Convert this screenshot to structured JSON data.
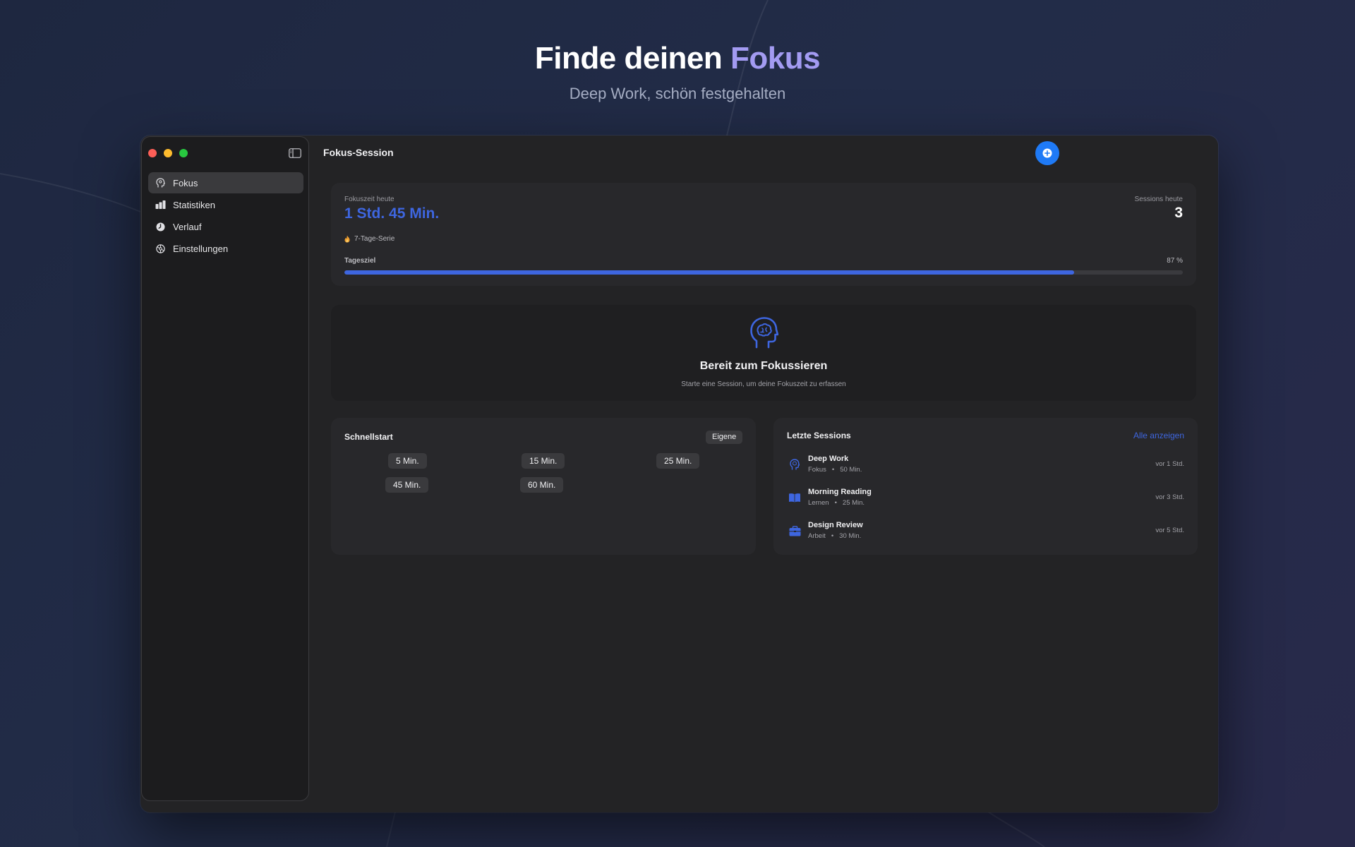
{
  "hero": {
    "title_prefix": "Finde deinen ",
    "title_accent": "Fokus",
    "subtitle": "Deep Work, schön festgehalten"
  },
  "sidebar": {
    "items": [
      {
        "label": "Fokus",
        "icon": "head-icon",
        "active": true
      },
      {
        "label": "Statistiken",
        "icon": "bar-chart-icon",
        "active": false
      },
      {
        "label": "Verlauf",
        "icon": "clock-icon",
        "active": false
      },
      {
        "label": "Einstellungen",
        "icon": "gear-icon",
        "active": false
      }
    ]
  },
  "main": {
    "title": "Fokus-Session"
  },
  "summary": {
    "focus_label": "Fokuszeit heute",
    "focus_value": "1 Std. 45 Min.",
    "sessions_label": "Sessions heute",
    "sessions_value": "3",
    "streak": "7-Tage-Serie",
    "goal_label": "Tagesziel",
    "goal_percent_text": "87 %",
    "goal_fraction": 0.87
  },
  "ready": {
    "title": "Bereit zum Fokussieren",
    "subtitle": "Starte eine Session, um deine Fokuszeit zu erfassen"
  },
  "quickstart": {
    "title": "Schnellstart",
    "custom_label": "Eigene",
    "presets": [
      "5 Min.",
      "15 Min.",
      "25 Min.",
      "45 Min.",
      "60 Min."
    ]
  },
  "recent": {
    "title": "Letzte Sessions",
    "show_all": "Alle anzeigen",
    "sessions": [
      {
        "name": "Deep Work",
        "category": "Fokus",
        "duration": "50 Min.",
        "time": "vor 1 Std.",
        "icon": "head-icon"
      },
      {
        "name": "Morning Reading",
        "category": "Lernen",
        "duration": "25 Min.",
        "time": "vor 3 Std.",
        "icon": "book-icon"
      },
      {
        "name": "Design Review",
        "category": "Arbeit",
        "duration": "30 Min.",
        "time": "vor 5 Std.",
        "icon": "briefcase-icon"
      }
    ]
  },
  "colors": {
    "accent": "#3e66e0",
    "hero_accent": "#a39bf2",
    "add_button": "#1f7af6",
    "window_bg": "#232325",
    "sidebar_bg": "#1c1c1e"
  }
}
